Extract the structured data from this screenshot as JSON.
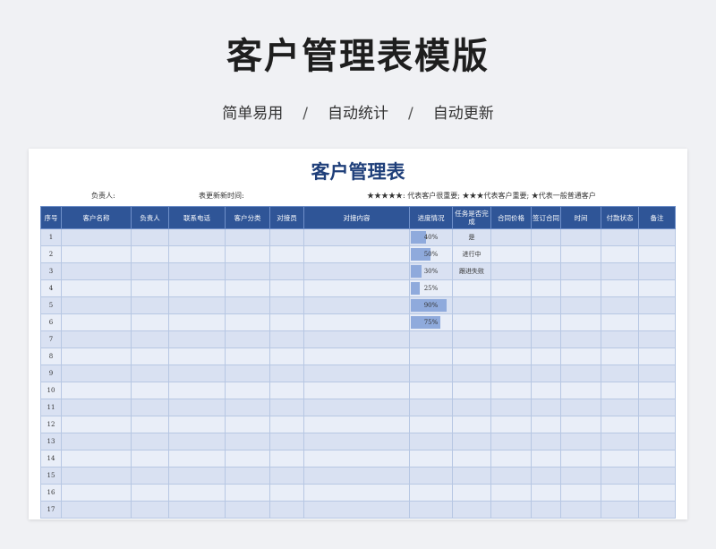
{
  "page": {
    "title": "客户管理表模版",
    "features": [
      "简单易用",
      "自动统计",
      "自动更新"
    ],
    "separator": "/"
  },
  "sheet": {
    "title": "客户管理表",
    "owner_label": "负责人:",
    "updated_label": "表更新新时间:",
    "legend": "★★★★★: 代表客户很重要; ★★★代表客户重要; ★代表一般普通客户"
  },
  "table": {
    "headers": [
      "序号",
      "客户名称",
      "负责人",
      "联系电话",
      "客户分类",
      "对接员",
      "对接内容",
      "进度情况",
      "任务是否完成",
      "合同价格",
      "签订合同",
      "时间",
      "付款状态",
      "备注"
    ],
    "rows": [
      {
        "no": "1",
        "progress": 40,
        "progress_label": "40%",
        "done": "是"
      },
      {
        "no": "2",
        "progress": 50,
        "progress_label": "50%",
        "done": "进行中"
      },
      {
        "no": "3",
        "progress": 30,
        "progress_label": "30%",
        "done": "跟进失败"
      },
      {
        "no": "4",
        "progress": 25,
        "progress_label": "25%",
        "done": ""
      },
      {
        "no": "5",
        "progress": 90,
        "progress_label": "90%",
        "done": ""
      },
      {
        "no": "6",
        "progress": 75,
        "progress_label": "75%",
        "done": ""
      },
      {
        "no": "7",
        "progress": null,
        "progress_label": "",
        "done": ""
      },
      {
        "no": "8",
        "progress": null,
        "progress_label": "",
        "done": ""
      },
      {
        "no": "9",
        "progress": null,
        "progress_label": "",
        "done": ""
      },
      {
        "no": "10",
        "progress": null,
        "progress_label": "",
        "done": ""
      },
      {
        "no": "11",
        "progress": null,
        "progress_label": "",
        "done": ""
      },
      {
        "no": "12",
        "progress": null,
        "progress_label": "",
        "done": ""
      },
      {
        "no": "13",
        "progress": null,
        "progress_label": "",
        "done": ""
      },
      {
        "no": "14",
        "progress": null,
        "progress_label": "",
        "done": ""
      },
      {
        "no": "15",
        "progress": null,
        "progress_label": "",
        "done": ""
      },
      {
        "no": "16",
        "progress": null,
        "progress_label": "",
        "done": ""
      },
      {
        "no": "17",
        "progress": null,
        "progress_label": "",
        "done": ""
      }
    ]
  },
  "colors": {
    "header_bg": "#2f5597",
    "row_odd": "#d9e1f2",
    "row_even": "#e9eef8",
    "progress_bar": "#8faadc",
    "sheet_title": "#1f3f7a"
  }
}
